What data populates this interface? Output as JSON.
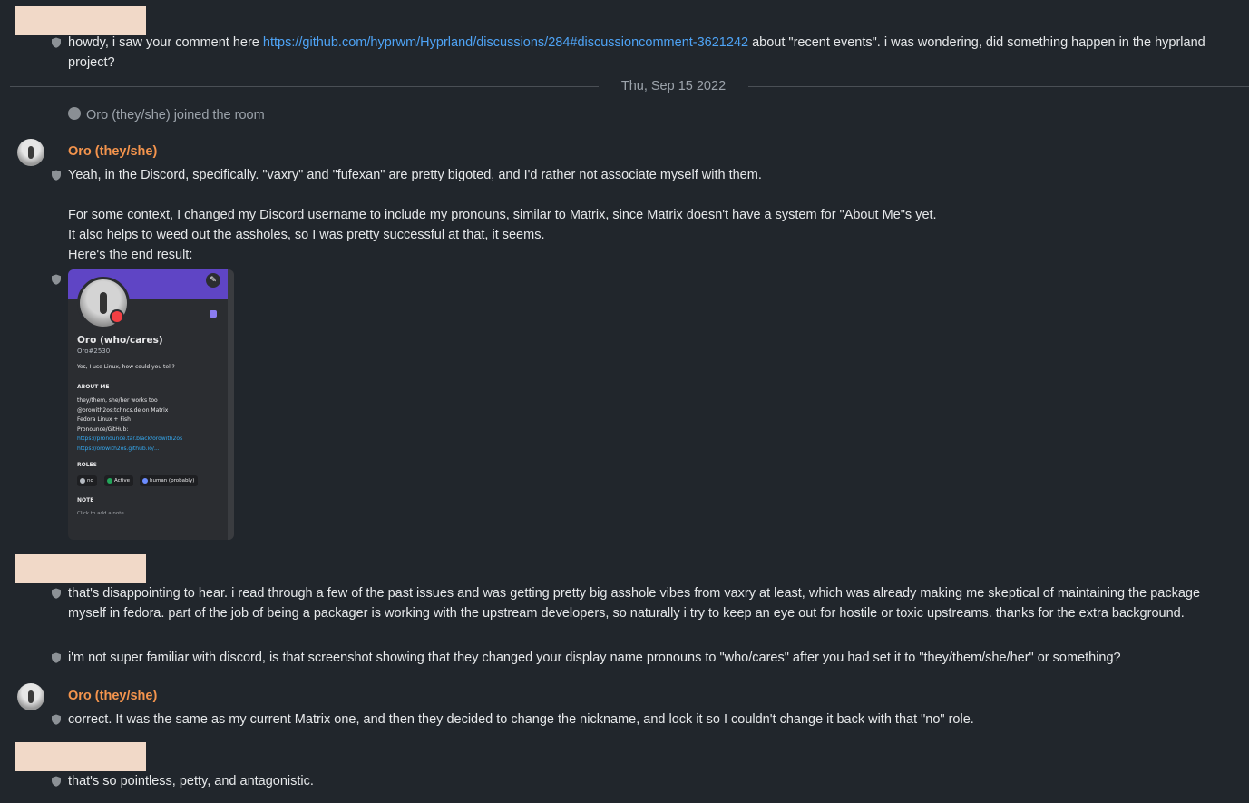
{
  "messages": {
    "m1_prefix": "howdy, i saw your comment here ",
    "m1_link": "https://github.com/hyprwm/Hyprland/discussions/284#discussioncomment-3621242",
    "m1_suffix": " about \"recent events\".  i was wondering, did something happen in the hyprland project?",
    "date_separator": "Thu, Sep 15 2022",
    "join_event": "Oro (they/she) joined the room",
    "sender_oro": "Oro (they/she)",
    "m2_line1": "Yeah, in the Discord, specifically. \"vaxry\" and \"fufexan\" are pretty bigoted, and I'd rather not associate myself with them.",
    "m2_line2": "For some context, I changed my Discord username to include my pronouns, similar to Matrix, since Matrix doesn't have a system for \"About Me\"s yet.",
    "m2_line3": "It also helps to weed out the assholes, so I was pretty successful at that, it seems.",
    "m2_line4": "Here's the end result:",
    "m3": "that's disappointing to hear.  i read through a few of the past issues and was getting pretty big asshole vibes from vaxry at least, which was already making me skeptical of maintaining the package myself in fedora.  part of the job of being a packager is working with the upstream developers, so naturally i try to keep an eye out for hostile or toxic upstreams.  thanks for the extra background.",
    "m4": "i'm not super familiar with discord, is that screenshot showing that they changed your display name pronouns to \"who/cares\" after you had set it to \"they/them/she/her\" or something?",
    "m5": "correct. It was the same as my current Matrix one, and then they decided to change the nickname, and lock it so I couldn't change it back with that \"no\" role.",
    "m6": "that's so pointless, petty, and antagonistic."
  },
  "screenshot": {
    "display_name": "Oro (who/cares)",
    "tag": "Oro#2530",
    "status": "Yes, I use Linux, how could you tell?",
    "about_heading": "ABOUT ME",
    "about_lines": [
      "they/them, she/her works too",
      "@orowith2os:tchncs.de on Matrix",
      "Fedora Linux + Fish",
      "Pronounce/GitHub:"
    ],
    "about_links": [
      "https://pronounce.tar.black/orowith2os",
      "https://orowith2os.github.io/..."
    ],
    "roles_heading": "ROLES",
    "roles": [
      {
        "label": "no",
        "color": "#b5bac1"
      },
      {
        "label": "Active",
        "color": "#23a55a"
      },
      {
        "label": "human (probably)",
        "color": "#6b8cff"
      }
    ],
    "note_heading": "NOTE",
    "note_hint": "Click to add a note"
  },
  "colors": {
    "background": "#21262c",
    "sender_name": "#f4944d",
    "link": "#4ea3f5",
    "discord_banner": "#5f45c5"
  },
  "icons": {
    "read_receipt": "shield-icon",
    "edit": "pencil-icon"
  }
}
